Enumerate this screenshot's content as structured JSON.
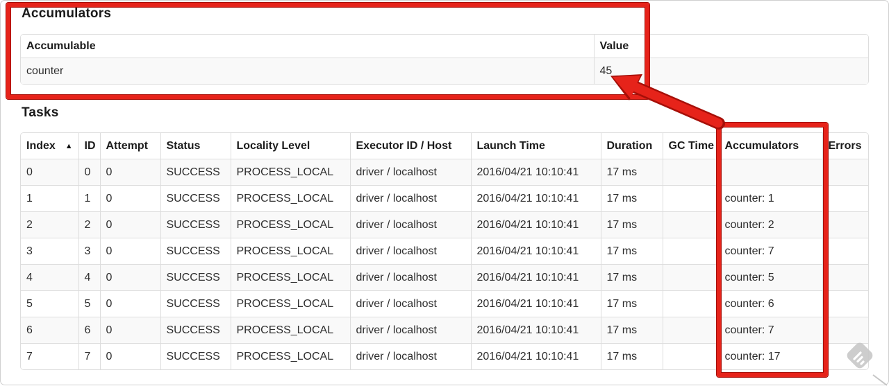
{
  "accumulators_section": {
    "heading": "Accumulators",
    "table": {
      "headers": [
        "Accumulable",
        "Value"
      ],
      "rows": [
        [
          "counter",
          "45"
        ]
      ]
    }
  },
  "tasks_section": {
    "heading": "Tasks",
    "table": {
      "headers": [
        "Index",
        "ID",
        "Attempt",
        "Status",
        "Locality Level",
        "Executor ID / Host",
        "Launch Time",
        "Duration",
        "GC Time",
        "Accumulators",
        "Errors"
      ],
      "sorted_column": "Index",
      "sort_direction": "ascending",
      "sort_indicator": "▲",
      "rows": [
        [
          "0",
          "0",
          "0",
          "SUCCESS",
          "PROCESS_LOCAL",
          "driver / localhost",
          "2016/04/21 10:10:41",
          "17 ms",
          "",
          "",
          ""
        ],
        [
          "1",
          "1",
          "0",
          "SUCCESS",
          "PROCESS_LOCAL",
          "driver / localhost",
          "2016/04/21 10:10:41",
          "17 ms",
          "",
          "counter: 1",
          ""
        ],
        [
          "2",
          "2",
          "0",
          "SUCCESS",
          "PROCESS_LOCAL",
          "driver / localhost",
          "2016/04/21 10:10:41",
          "17 ms",
          "",
          "counter: 2",
          ""
        ],
        [
          "3",
          "3",
          "0",
          "SUCCESS",
          "PROCESS_LOCAL",
          "driver / localhost",
          "2016/04/21 10:10:41",
          "17 ms",
          "",
          "counter: 7",
          ""
        ],
        [
          "4",
          "4",
          "0",
          "SUCCESS",
          "PROCESS_LOCAL",
          "driver / localhost",
          "2016/04/21 10:10:41",
          "17 ms",
          "",
          "counter: 5",
          ""
        ],
        [
          "5",
          "5",
          "0",
          "SUCCESS",
          "PROCESS_LOCAL",
          "driver / localhost",
          "2016/04/21 10:10:41",
          "17 ms",
          "",
          "counter: 6",
          ""
        ],
        [
          "6",
          "6",
          "0",
          "SUCCESS",
          "PROCESS_LOCAL",
          "driver / localhost",
          "2016/04/21 10:10:41",
          "17 ms",
          "",
          "counter: 7",
          ""
        ],
        [
          "7",
          "7",
          "0",
          "SUCCESS",
          "PROCESS_LOCAL",
          "driver / localhost",
          "2016/04/21 10:10:41",
          "17 ms",
          "",
          "counter: 17",
          ""
        ]
      ]
    }
  },
  "annotations": {
    "highlight_color": "#e6231a",
    "highlight_edge_color": "#a60f08",
    "boxes": [
      "accumulators-section",
      "tasks-accumulators-column"
    ],
    "arrow": {
      "points_to": "45"
    }
  },
  "watermark": {
    "name": "feedly-logo",
    "color": "#c8c8c8"
  }
}
